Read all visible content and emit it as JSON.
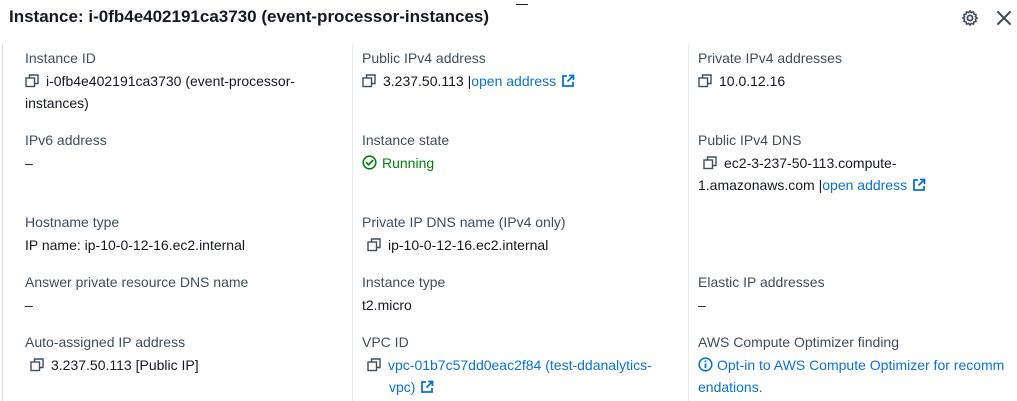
{
  "header": {
    "title": "Instance: i-0fb4e402191ca3730 (event-processor-instances)"
  },
  "icons": {
    "settings": "settings-gear-icon",
    "close": "close-x-icon",
    "copy": "copy-icon",
    "external": "external-link-icon",
    "success": "check-circle-icon",
    "info": "info-circle-icon"
  },
  "colors": {
    "link": "#0972d3",
    "success": "#037f0c",
    "label": "#414d5c",
    "text": "#16191f"
  },
  "fields": {
    "instance_id": {
      "label": "Instance ID",
      "line1": "i-0fb4e402191ca3730 (event-processor-",
      "line2": "instances)"
    },
    "public_ipv4": {
      "label": "Public IPv4 address",
      "value": "3.237.50.113 |",
      "link": "open address"
    },
    "private_ipv4": {
      "label": "Private IPv4 addresses",
      "value": "10.0.12.16"
    },
    "ipv6": {
      "label": "IPv6 address",
      "value": "–"
    },
    "instance_state": {
      "label": "Instance state",
      "value": "Running"
    },
    "public_dns": {
      "label": "Public IPv4 DNS",
      "line1": "ec2-3-237-50-113.compute-",
      "line2": "1.amazonaws.com |",
      "link": "open address"
    },
    "hostname_type": {
      "label": "Hostname type",
      "value": "IP name: ip-10-0-12-16.ec2.internal"
    },
    "private_dns": {
      "label": "Private IP DNS name (IPv4 only)",
      "value": "ip-10-0-12-16.ec2.internal"
    },
    "answer_dns": {
      "label": "Answer private resource DNS name",
      "value": "–"
    },
    "instance_type": {
      "label": "Instance type",
      "value": "t2.micro"
    },
    "elastic_ip": {
      "label": "Elastic IP addresses",
      "value": "–"
    },
    "auto_ip": {
      "label": "Auto-assigned IP address",
      "value": "3.237.50.113 [Public IP]"
    },
    "vpc_id": {
      "label": "VPC ID",
      "line1": "vpc-01b7c57dd0eac2f84 (test-ddanalytics-",
      "line2": "vpc)"
    },
    "optimizer": {
      "label": "AWS Compute Optimizer finding",
      "line1": "Opt-in to AWS Compute Optimizer for recomm",
      "line2": "endations."
    }
  }
}
